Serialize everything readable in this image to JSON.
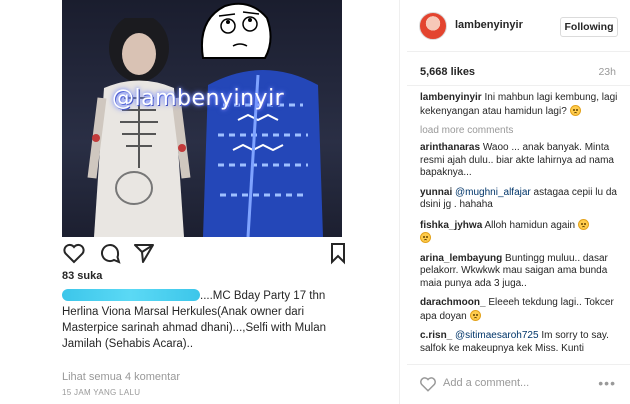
{
  "post": {
    "watermark": "@lambenyinyir",
    "likes_left": "83 suka",
    "caption_after_blur": "....MC Bday Party 17 thn",
    "caption_line2": "Herlina Viona Marsal Herkules(Anak owner dari",
    "caption_line3": "Masterpice sarinah ahmad dhani)...,Selfi with Mulan",
    "caption_line4": "Jamilah (Sehabis Acara)..",
    "view_comments": "Lihat semua 4 komentar",
    "time_ago": "15 JAM YANG LALU"
  },
  "header": {
    "username": "lambenyinyir",
    "follow_label": "Following"
  },
  "stats": {
    "likes": "5,668 likes",
    "time": "23h"
  },
  "caption": {
    "username": "lambenyinyir",
    "text": "Ini mahbun lagi kembung, lagi kekenyangan atau hamidun lagi?"
  },
  "load_more": "load more comments",
  "comments": [
    {
      "username": "arinthanaras",
      "text": "Waoo ... anak banyak. Minta resmi ajah dulu.. biar akte lahirnya ad nama bapaknya..."
    },
    {
      "username": "yunnai",
      "mention": "@mughni_alfajar",
      "text": "astagaa cepii lu da dsini jg . hahaha"
    },
    {
      "username": "fishka_jyhwa",
      "text": "Alloh hamidun again"
    },
    {
      "username": "arina_lembayung",
      "text": "Buntingg muluu.. dasar pelakorr. Wkwkwk mau saigan ama bunda maia punya ada 3 juga.."
    },
    {
      "username": "darachmoon_",
      "text": "Eleeeh tekdung lagi.. Tokcer apa doyan"
    },
    {
      "username": "c.risn_",
      "mention": "@sitimaesaroh725",
      "text": "Im sorry to say. salfok ke makeupnya kek Miss. Kunti"
    }
  ],
  "add_comment": {
    "placeholder": "Add a comment...",
    "more": "•••"
  }
}
